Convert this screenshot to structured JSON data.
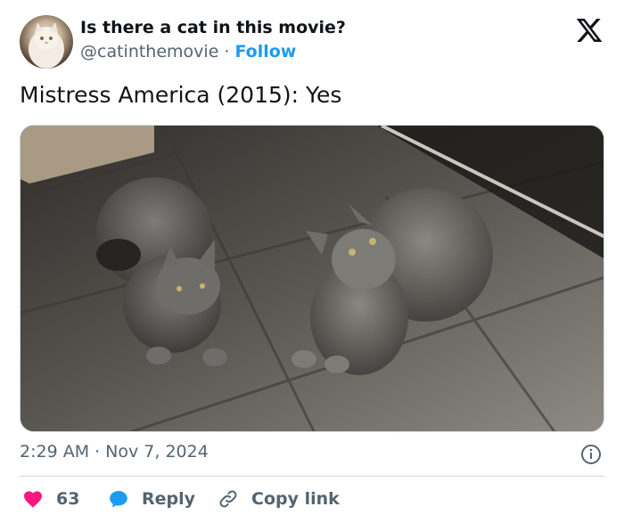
{
  "author": {
    "name": "Is there a cat in this movie?",
    "handle": "@catinthemovie",
    "separator": "·",
    "follow_label": "Follow",
    "avatar_icon": "white-cat-avatar"
  },
  "platform_icon": "x-logo-icon",
  "tweet": {
    "text": "Mistress America (2015): Yes",
    "media_icon": "two-tabby-cats-photo"
  },
  "meta": {
    "time": "2:29 AM",
    "separator": "·",
    "date": "Nov 7, 2024",
    "info_icon": "info-icon"
  },
  "actions": {
    "like_count": "63",
    "reply_label": "Reply",
    "copy_label": "Copy link"
  },
  "colors": {
    "accent": "#1d9bf0",
    "like": "#f91880",
    "secondary_text": "#536471",
    "primary_text": "#0f1419",
    "border": "#cfd9de"
  }
}
